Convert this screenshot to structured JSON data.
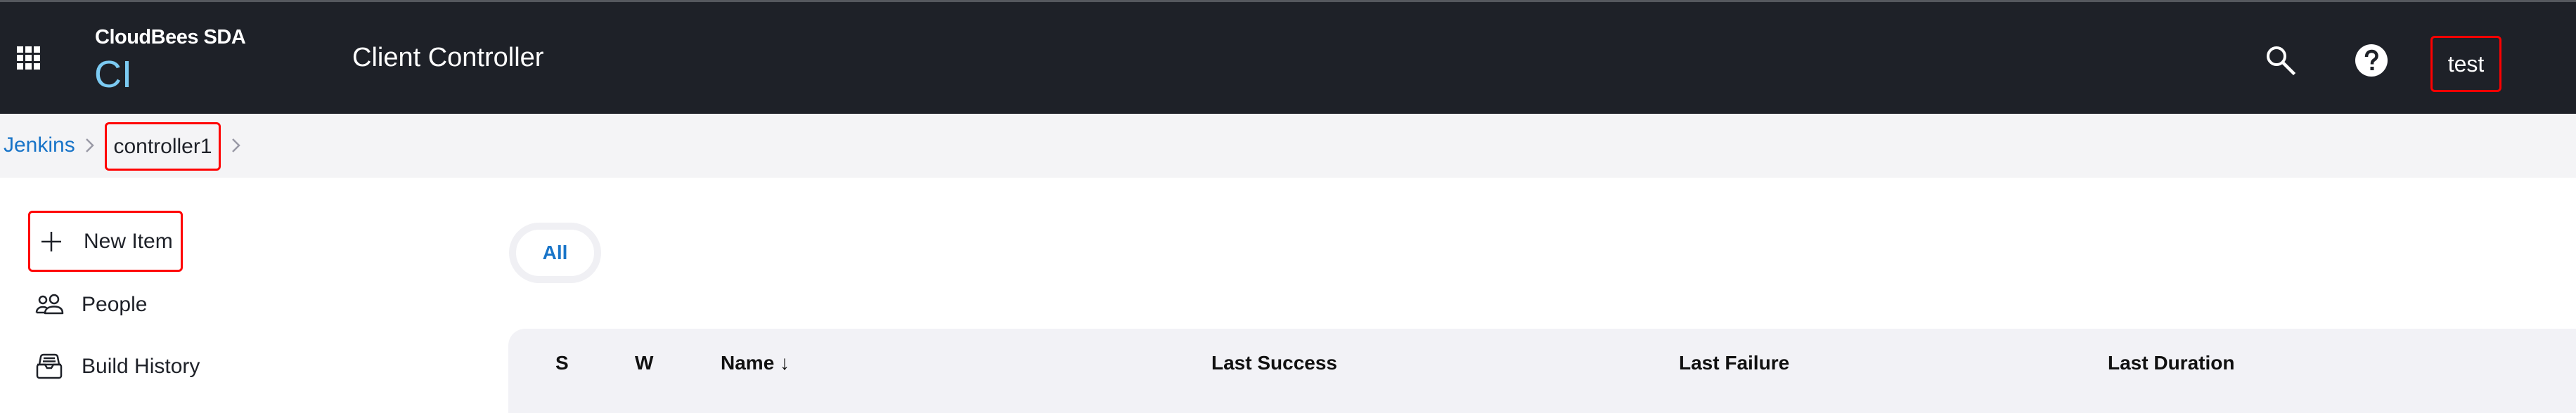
{
  "header": {
    "apps_icon": "apps-grid-icon",
    "brand": "CloudBees SDA",
    "brand_product": "CI",
    "title": "Client Controller",
    "search_icon": "search-icon",
    "help_icon": "help-icon",
    "user": "test"
  },
  "breadcrumb": {
    "items": [
      {
        "label": "Jenkins"
      },
      {
        "label": "controller1"
      }
    ],
    "separator_icon": "chevron-right-icon"
  },
  "sidebar": {
    "items": [
      {
        "label": "New Item",
        "icon": "plus-icon"
      },
      {
        "label": "People",
        "icon": "people-icon"
      },
      {
        "label": "Build History",
        "icon": "inbox-icon"
      }
    ]
  },
  "views": {
    "tabs": [
      {
        "label": "All",
        "active": true
      }
    ]
  },
  "table": {
    "columns": [
      {
        "label": "S"
      },
      {
        "label": "W"
      },
      {
        "label": "Name ↓",
        "sort": "descending"
      },
      {
        "label": "Last Success"
      },
      {
        "label": "Last Failure"
      },
      {
        "label": "Last Duration"
      }
    ]
  },
  "colors": {
    "header_bg": "#1e2128",
    "brand_accent": "#7ccbf3",
    "link": "#1874c8",
    "highlight_border": "#ff0000",
    "breadcrumb_bg": "#f4f4f6",
    "table_header_bg": "#f2f2f6"
  }
}
